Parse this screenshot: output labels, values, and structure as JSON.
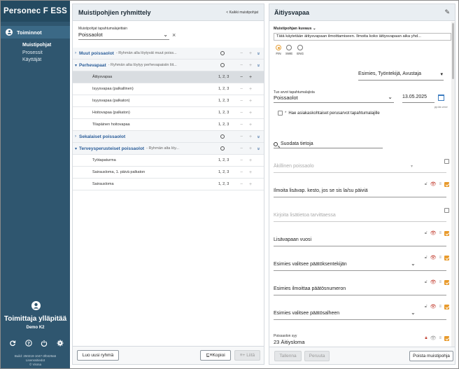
{
  "sidebar": {
    "brand": "Personec F ESS",
    "section": "Toiminnot",
    "items": [
      "Muistipohjat",
      "Prosessit",
      "Käyttäjät"
    ],
    "user_name": "Toimittaja ylläpitää",
    "user_org": "Demo K2",
    "build_line1": "Build: 250219-1047-3f0429a5",
    "build_line2": "Lisenssitiedot",
    "build_line3": "© Visma"
  },
  "middle": {
    "title": "Muistipohjien ryhmittely",
    "all_link": "< Kaikki muistipohjat",
    "filter_label": "Muistipohjat tapahtumalajeittain",
    "filter_value": "Poissaolot",
    "rows": [
      {
        "type": "group",
        "name": "Muut poissaolot",
        "desc": "- Ryhmän alla löytyvät muut poiss..."
      },
      {
        "type": "group",
        "name": "Perhevapaat",
        "desc": "- Ryhmän alta löytyy perhevapaisiin liit..."
      },
      {
        "type": "item",
        "name": "Äitiysvapaa",
        "meta": "1, 2, 3"
      },
      {
        "type": "item",
        "name": "Isyysvapaa (palkallinen)",
        "meta": "1, 2, 3"
      },
      {
        "type": "item",
        "name": "Isyysvapaa (palkaton)",
        "meta": "1, 2, 3"
      },
      {
        "type": "item",
        "name": "Hoitovapaa (palkaton)",
        "meta": "1, 2, 3"
      },
      {
        "type": "item",
        "name": "Tilapäinen hoitovapaa",
        "meta": "1, 2, 3"
      },
      {
        "type": "group",
        "name": "Sekalaiset poissaolot",
        "desc": ""
      },
      {
        "type": "group",
        "name": "Terveysperusteiset poissaolot",
        "desc": "- Ryhmän alta löy..."
      },
      {
        "type": "item",
        "name": "Työtapaturma",
        "meta": "1, 2, 3"
      },
      {
        "type": "item",
        "name": "Sairausloma, 1. päivä palkaton",
        "meta": "1, 2, 3"
      },
      {
        "type": "item",
        "name": "Sairausloma",
        "meta": "1, 2, 3"
      }
    ],
    "new_group_button": "Luo uusi ryhmä",
    "copy_button": "Kopioi",
    "paste_button": "Liitä"
  },
  "right": {
    "title": "Äitiysvapaa",
    "desc_label": "Muistipohjan kuvaus",
    "desc_value": "Tätä käytetään äitiysvapaan ilmoittamiseen. Ilmoita koko äitiysvapaan aika yhd...",
    "langs": [
      "FIN",
      "SWE",
      "ENG"
    ],
    "roles_value": "Esimies, Työntekijä, Avustaja",
    "event_type_label": "Tuo arvot tapahtumalajista",
    "event_type_value": "Poissaolot",
    "date_value": "13.05.2025",
    "date_hint": "pp.kk.vvvv",
    "fetch_defaults_label": "Hae asiakaskohtaiset perusarvot tapahtumalajille",
    "filter_placeholder": "Suodata tietoja",
    "fields": [
      {
        "text": "Äkillinen poissaolo",
        "placeholder": true
      },
      {
        "text": "Ilmoita lisävap. kesto, jos se sis la/su päiviä",
        "placeholder": false
      },
      {
        "text": "Kirjoita lisätietoa tarvittaessa",
        "placeholder": true
      },
      {
        "text": "Lisävapaan vuosi",
        "placeholder": false
      },
      {
        "text": "Esimies valitsee päätöksentekijän",
        "placeholder": false
      },
      {
        "text": "Esimies ilmoittaa päätösnumeron",
        "placeholder": false
      },
      {
        "text": "Esimies valitsee päätösalheen",
        "placeholder": false
      }
    ],
    "reason_label": "Poissaolon syy",
    "reason_value": "23 Äitiysloma",
    "save_button": "Tallenna",
    "cancel_button": "Peruuta",
    "delete_button": "Poista muistipohja"
  }
}
